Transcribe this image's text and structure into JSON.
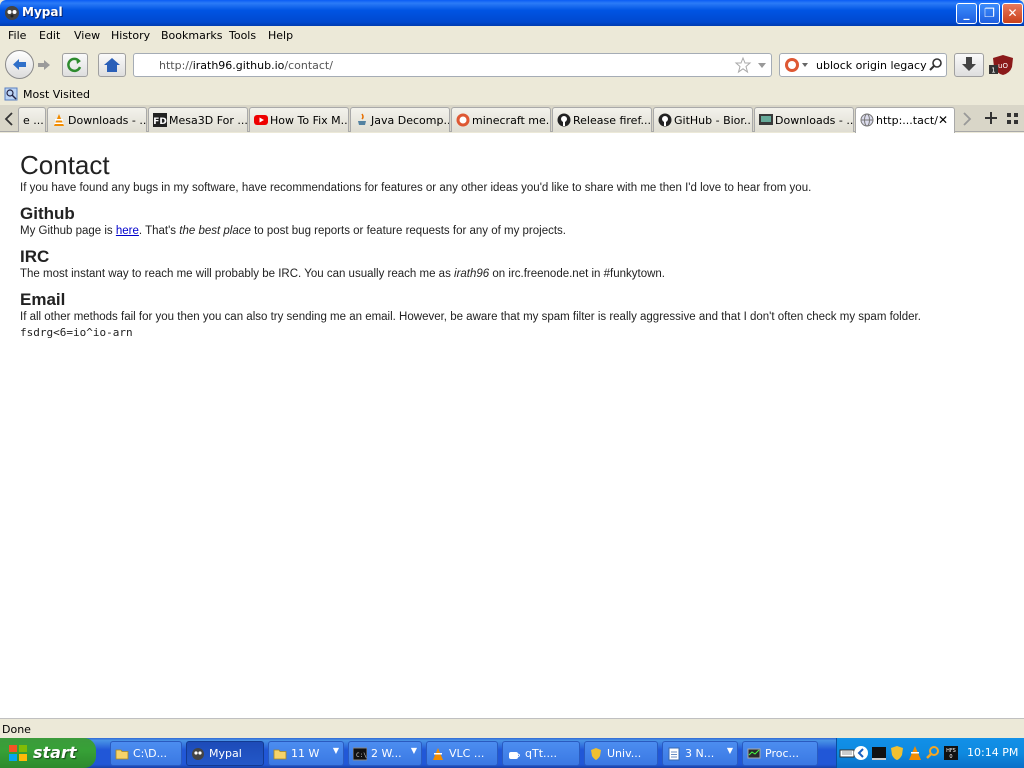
{
  "window": {
    "title": "Mypal"
  },
  "menu": [
    "File",
    "Edit",
    "View",
    "History",
    "Bookmarks",
    "Tools",
    "Help"
  ],
  "nav": {
    "url_prefix": "http://",
    "url_host": "irath96.github.io",
    "url_path": "/contact/",
    "search_value": "ublock origin legacy"
  },
  "bookmarks": {
    "most_visited": "Most Visited"
  },
  "tabs": [
    {
      "label": "e ...",
      "icon": "page-icon"
    },
    {
      "label": "Downloads - ...",
      "icon": "vlc-icon"
    },
    {
      "label": "Mesa3D For ...",
      "icon": "fd-icon"
    },
    {
      "label": "How To Fix M...",
      "icon": "youtube-icon"
    },
    {
      "label": "Java Decomp...",
      "icon": "java-icon"
    },
    {
      "label": "minecraft me...",
      "icon": "duckduckgo-icon"
    },
    {
      "label": "Release firef...",
      "icon": "github-icon"
    },
    {
      "label": "GitHub - Bior...",
      "icon": "github-icon"
    },
    {
      "label": "Downloads - ...",
      "icon": "sourceforge-icon"
    },
    {
      "label": "http:...tact/",
      "icon": "globe-icon",
      "active": true
    }
  ],
  "page": {
    "title": "Contact",
    "intro": "If you have found any bugs in my software, have recommendations for features or any other ideas you'd like to share with me then I'd love to hear from you.",
    "github_heading": "Github",
    "github_before": "My Github page is ",
    "github_link": "here",
    "github_mid": ". That's ",
    "github_em": "the best place",
    "github_after": " to post bug reports or feature requests for any of my projects.",
    "irc_heading": "IRC",
    "irc_before": "The most instant way to reach me will probably be IRC. You can usually reach me as ",
    "irc_em": "irath96",
    "irc_after": " on irc.freenode.net in #funkytown.",
    "email_heading": "Email",
    "email_text": "If all other methods fail for you then you can also try sending me an email. However, be aware that my spam filter is really aggressive and that I don't often check my spam folder.",
    "email_obfuscated": "fsdrg<6=io^io-arn"
  },
  "status": {
    "text": "Done"
  },
  "taskbar": {
    "start_label": "start",
    "tasks": [
      {
        "label": "C:\\D...",
        "icon": "folder-icon"
      },
      {
        "label": "Mypal",
        "icon": "mypal-icon",
        "active": true
      },
      {
        "label": "11 W",
        "icon": "folder-icon",
        "group": true
      },
      {
        "label": "2 W...",
        "icon": "cmd-icon",
        "group": true
      },
      {
        "label": "VLC ...",
        "icon": "vlc-icon"
      },
      {
        "label": "qTt....",
        "icon": "qt-icon"
      },
      {
        "label": "Univ...",
        "icon": "shield-icon"
      },
      {
        "label": "3 N...",
        "icon": "notepad-icon",
        "group": true
      },
      {
        "label": "Proc...",
        "icon": "monitor-icon"
      }
    ],
    "clock": "10:14 PM"
  }
}
